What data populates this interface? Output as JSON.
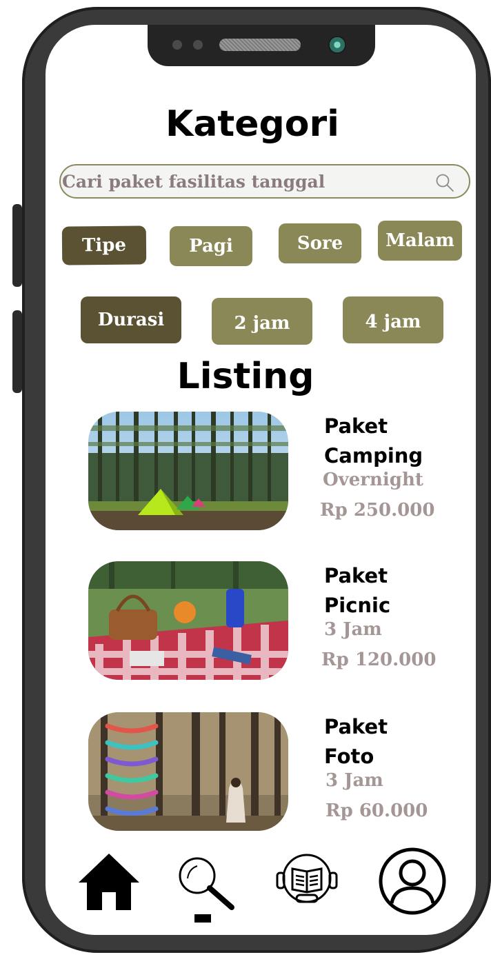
{
  "page": {
    "title": "Kategori",
    "search_placeholder": "Cari paket fasilitas tanggal",
    "listing_title": "Listing"
  },
  "filters": {
    "tipe_label": "Tipe",
    "tipe_options": [
      "Pagi",
      "Sore",
      "Malam"
    ],
    "durasi_label": "Durasi",
    "durasi_options": [
      "2 jam",
      "4 jam"
    ]
  },
  "listings": [
    {
      "title_line1": "Paket",
      "title_line2": "Camping",
      "duration": "Overnight",
      "price": "Rp 250.000",
      "image": "camping-forest"
    },
    {
      "title_line1": "Paket",
      "title_line2": "Picnic",
      "duration": "3 Jam",
      "price": "Rp 120.000",
      "image": "picnic-blanket"
    },
    {
      "title_line1": "Paket",
      "title_line2": "Foto",
      "duration": "3 Jam",
      "price": "Rp 60.000",
      "image": "hammock-forest"
    }
  ],
  "bottom_nav": {
    "items": [
      "home-icon",
      "search-icon",
      "guide-book-icon",
      "profile-icon"
    ],
    "active": "search"
  },
  "colors": {
    "chip_dark": "#5a5233",
    "chip_light": "#8b8858",
    "price_text": "#a59696"
  }
}
